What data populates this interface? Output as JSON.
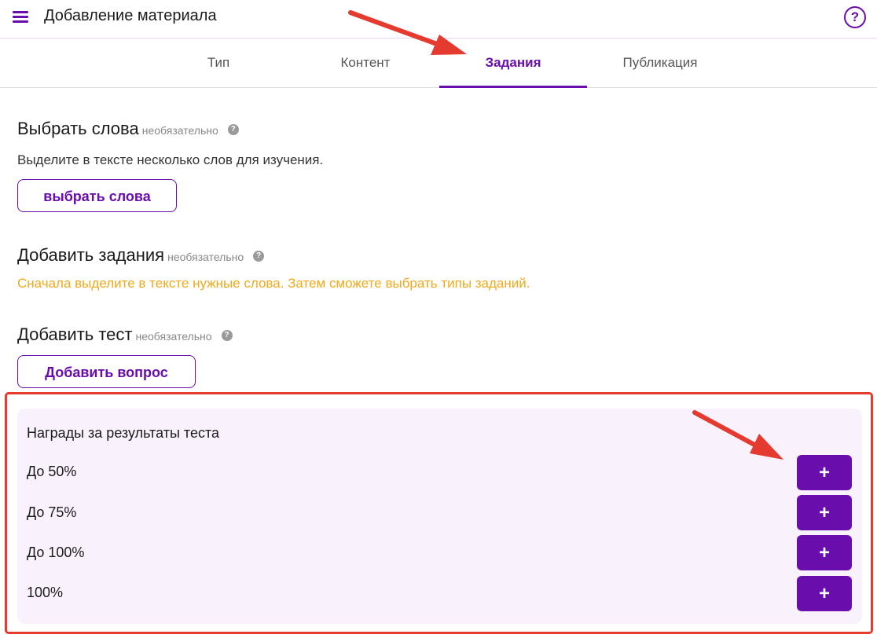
{
  "header": {
    "title": "Добавление материала",
    "menu_icon": "hamburger-menu-icon",
    "help_icon": "help-circle-icon",
    "help_glyph": "?"
  },
  "tabs": [
    {
      "label": "Тип",
      "active": false
    },
    {
      "label": "Контент",
      "active": false
    },
    {
      "label": "Задания",
      "active": true
    },
    {
      "label": "Публикация",
      "active": false
    }
  ],
  "select_words": {
    "title": "Выбрать слова",
    "optional": "необязательно",
    "description": "Выделите в тексте несколько слов для изучения.",
    "button": "выбрать слова"
  },
  "add_tasks": {
    "title": "Добавить задания",
    "optional": "необязательно",
    "warning": "Сначала выделите в тексте нужные слова. Затем сможете выбрать типы заданий."
  },
  "add_test": {
    "title": "Добавить тест",
    "optional": "необязательно",
    "button": "Добавить вопрос"
  },
  "rewards": {
    "title": "Награды за результаты теста",
    "rows": [
      {
        "label": "До 50%",
        "button": "+"
      },
      {
        "label": "До 75%",
        "button": "+"
      },
      {
        "label": "До 100%",
        "button": "+"
      },
      {
        "label": "100%",
        "button": "+"
      }
    ]
  },
  "hint_glyph": "?",
  "colors": {
    "accent": "#6a0dad",
    "warning": "#f2a91b",
    "annotation": "#e53a2f",
    "rewards_bg": "#f9f1fb"
  }
}
